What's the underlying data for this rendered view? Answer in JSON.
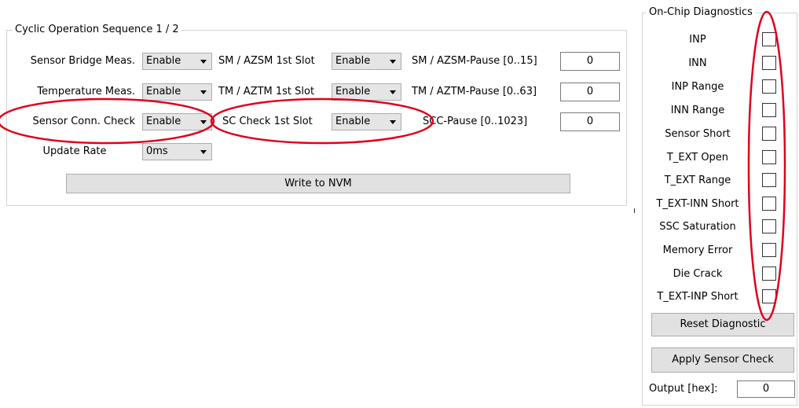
{
  "cyclic": {
    "title": "Cyclic Operation Sequence 1 / 2",
    "rows": [
      {
        "label": "Sensor Bridge Meas.",
        "select": "Enable",
        "slot_label": "SM / AZSM 1st Slot",
        "slot_select": "Enable",
        "pause_label": "SM / AZSM-Pause [0..15]",
        "pause_value": "0"
      },
      {
        "label": "Temperature Meas.",
        "select": "Enable",
        "slot_label": "TM / AZTM 1st Slot",
        "slot_select": "Enable",
        "pause_label": "TM / AZTM-Pause [0..63]",
        "pause_value": "0"
      },
      {
        "label": "Sensor Conn. Check",
        "select": "Enable",
        "slot_label": "SC Check 1st Slot",
        "slot_select": "Enable",
        "pause_label": "SCC-Pause [0..1023]",
        "pause_value": "0"
      }
    ],
    "update_rate_label": "Update Rate",
    "update_rate_value": "0ms",
    "write_button": "Write to NVM"
  },
  "diagnostics": {
    "title": "On-Chip Diagnostics",
    "items": [
      "INP",
      "INN",
      "INP Range",
      "INN Range",
      "Sensor Short",
      "T_EXT Open",
      "T_EXT Range",
      "T_EXT-INN Short",
      "SSC Saturation",
      "Memory Error",
      "Die Crack",
      "T_EXT-INP Short"
    ],
    "reset_button": "Reset Diagnostic",
    "apply_button": "Apply Sensor Check",
    "output_label": "Output [hex]:",
    "output_value": "0"
  },
  "annotation_color": "#e0001a"
}
